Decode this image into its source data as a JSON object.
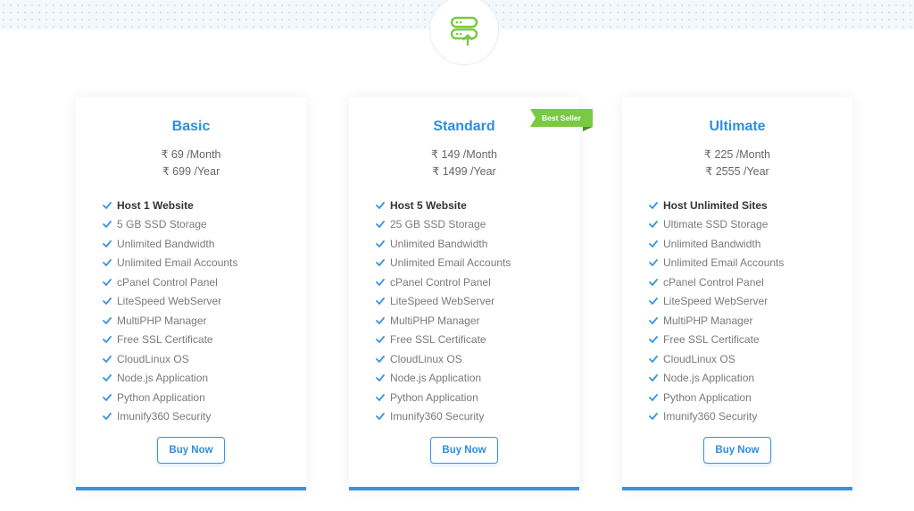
{
  "colors": {
    "accent": "#3a93e0",
    "badge": "#7ac943",
    "icon": "#7ac943"
  },
  "header": {
    "icon": "server-upload-icon"
  },
  "plans": [
    {
      "name": "Basic",
      "price_monthly": "₹ 69 /Month",
      "price_yearly": "₹ 699 /Year",
      "features": [
        "Host 1 Website",
        "5 GB SSD Storage",
        "Unlimited Bandwidth",
        "Unlimited Email Accounts",
        "cPanel Control Panel",
        "LiteSpeed WebServer",
        "MultiPHP Manager",
        "Free SSL Certificate",
        "CloudLinux OS",
        "Node.js Application",
        "Python Application",
        "Imunify360 Security"
      ],
      "button": "Buy Now"
    },
    {
      "name": "Standard",
      "badge": "Best Seller",
      "price_monthly": "₹ 149 /Month",
      "price_yearly": "₹ 1499 /Year",
      "features": [
        "Host 5 Website",
        "25 GB SSD Storage",
        "Unlimited Bandwidth",
        "Unlimited Email Accounts",
        "cPanel Control Panel",
        "LiteSpeed WebServer",
        "MultiPHP Manager",
        "Free SSL Certificate",
        "CloudLinux OS",
        "Node.js Application",
        "Python Application",
        "Imunify360 Security"
      ],
      "button": "Buy Now"
    },
    {
      "name": "Ultimate",
      "price_monthly": "₹ 225 /Month",
      "price_yearly": "₹ 2555 /Year",
      "features": [
        "Host Unlimited Sites",
        "Ultimate SSD Storage",
        "Unlimited Bandwidth",
        "Unlimited Email Accounts",
        "cPanel Control Panel",
        "LiteSpeed WebServer",
        "MultiPHP Manager",
        "Free SSL Certificate",
        "CloudLinux OS",
        "Node.js Application",
        "Python Application",
        "Imunify360 Security"
      ],
      "button": "Buy Now"
    }
  ]
}
